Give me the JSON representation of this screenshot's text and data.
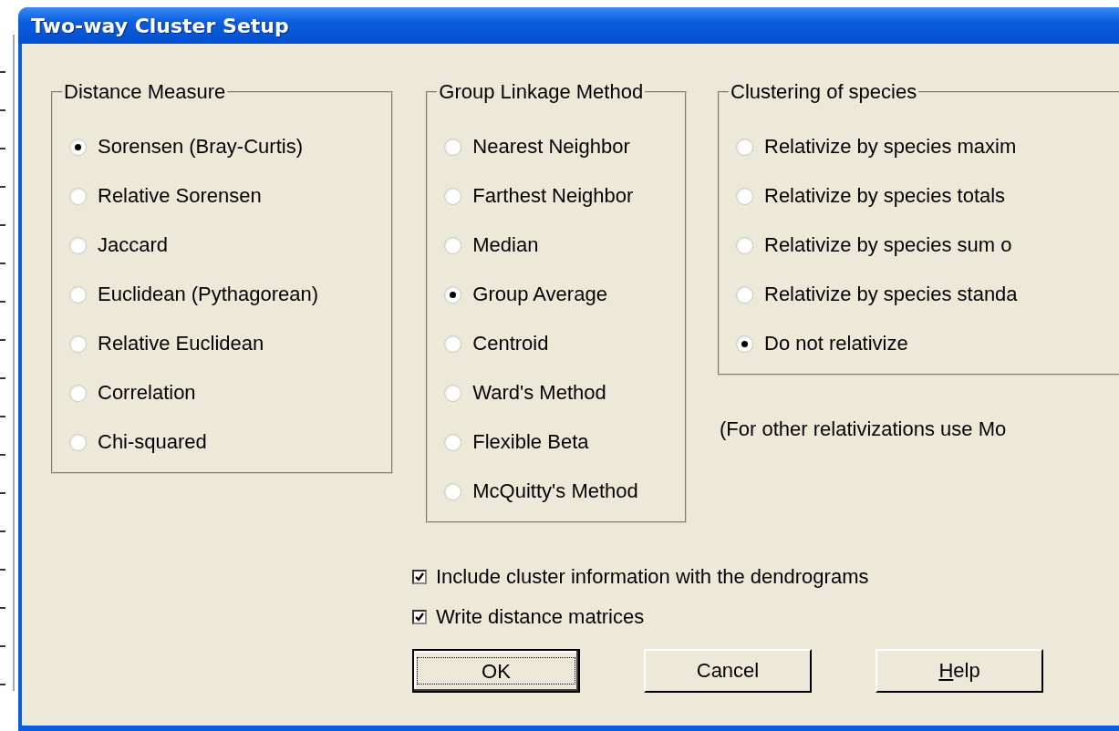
{
  "window": {
    "title": "Two-way Cluster Setup"
  },
  "groups": [
    {
      "title": "Distance Measure",
      "options": [
        {
          "label": "Sorensen (Bray-Curtis)",
          "selected": true
        },
        {
          "label": "Relative Sorensen",
          "selected": false
        },
        {
          "label": "Jaccard",
          "selected": false
        },
        {
          "label": "Euclidean (Pythagorean)",
          "selected": false
        },
        {
          "label": "Relative Euclidean",
          "selected": false
        },
        {
          "label": "Correlation",
          "selected": false
        },
        {
          "label": "Chi-squared",
          "selected": false
        }
      ]
    },
    {
      "title": "Group Linkage Method",
      "options": [
        {
          "label": "Nearest Neighbor",
          "selected": false
        },
        {
          "label": "Farthest Neighbor",
          "selected": false
        },
        {
          "label": "Median",
          "selected": false
        },
        {
          "label": "Group Average",
          "selected": true
        },
        {
          "label": "Centroid",
          "selected": false
        },
        {
          "label": "Ward's Method",
          "selected": false
        },
        {
          "label": "Flexible Beta",
          "selected": false
        },
        {
          "label": "McQuitty's Method",
          "selected": false
        }
      ]
    },
    {
      "title": "Clustering of species",
      "options": [
        {
          "label": "Relativize by species maxim",
          "selected": false
        },
        {
          "label": "Relativize by species totals",
          "selected": false
        },
        {
          "label": "Relativize by species sum o",
          "selected": false
        },
        {
          "label": "Relativize by species standa",
          "selected": false
        },
        {
          "label": "Do not relativize",
          "selected": true
        }
      ],
      "note": "(For other relativizations use Mo"
    }
  ],
  "checkboxes": [
    {
      "label": "Include cluster information with the dendrograms",
      "checked": true
    },
    {
      "label": "Write distance matrices",
      "checked": true
    }
  ],
  "buttons": [
    {
      "label": "OK",
      "focused": true,
      "mnemonic": false
    },
    {
      "label": "Cancel",
      "focused": false,
      "mnemonic": false
    },
    {
      "label": "Help",
      "focused": false,
      "mnemonic": true
    }
  ]
}
